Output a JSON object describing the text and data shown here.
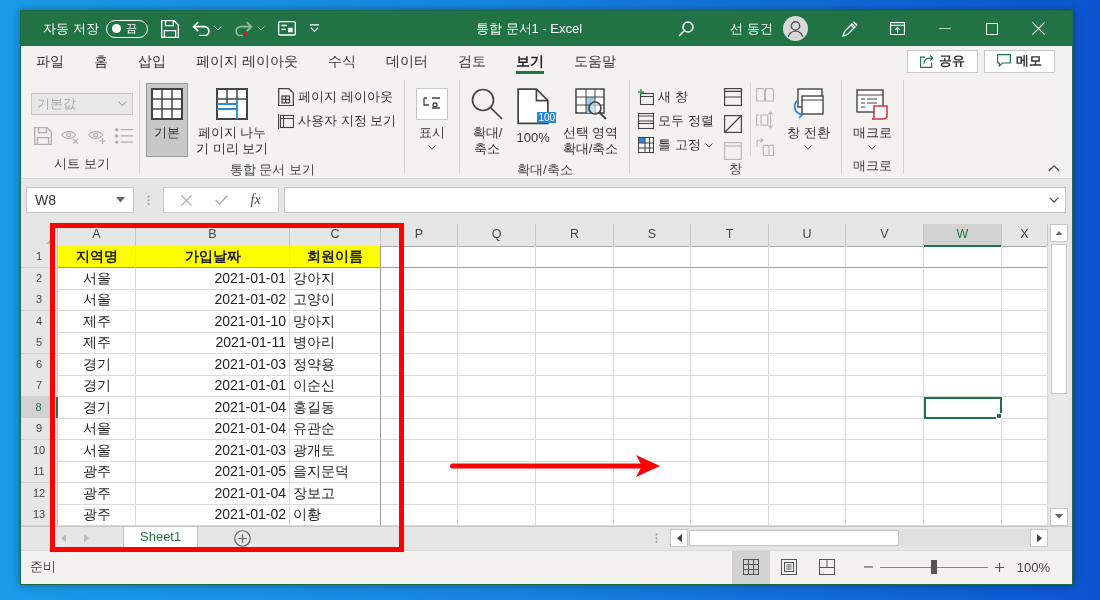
{
  "title_bar": {
    "autosave": {
      "label": "자동 저장",
      "state": "끔",
      "on": false
    },
    "quick_access": [
      {
        "kind": "save",
        "disabled": false,
        "dropdown": false
      },
      {
        "kind": "undo",
        "disabled": false,
        "dropdown": true
      },
      {
        "kind": "redo",
        "disabled": true,
        "dropdown": true
      },
      {
        "kind": "form",
        "disabled": false,
        "dropdown": false
      }
    ],
    "title": "통합 문서1 - Excel",
    "user": "선 동건"
  },
  "tabs": [
    {
      "label": "파일",
      "selected": false
    },
    {
      "label": "홈",
      "selected": false
    },
    {
      "label": "삽입",
      "selected": false
    },
    {
      "label": "페이지 레이아웃",
      "selected": false
    },
    {
      "label": "수식",
      "selected": false
    },
    {
      "label": "데이터",
      "selected": false
    },
    {
      "label": "검토",
      "selected": false
    },
    {
      "label": "보기",
      "selected": true
    },
    {
      "label": "도움말",
      "selected": false
    }
  ],
  "actions": [
    {
      "kind": "share",
      "label": "공유"
    },
    {
      "kind": "comment",
      "label": "메모"
    }
  ],
  "ribbon": {
    "groups": [
      {
        "kind": "sheet_view",
        "label": "시트 보기",
        "dropdown": {
          "value": "기본값",
          "disabled": true
        },
        "buttons": [
          {
            "kind": "save_view",
            "disabled": true
          },
          {
            "kind": "exit_view",
            "disabled": true
          },
          {
            "kind": "new_view",
            "disabled": true
          },
          {
            "kind": "view_options",
            "disabled": true
          }
        ]
      },
      {
        "kind": "commands",
        "label": "통합 문서 보기",
        "columns": [
          [
            {
              "kind": "normal_view",
              "lines": [
                "기본"
              ],
              "selected": true
            }
          ],
          [
            {
              "kind": "page_break_preview",
              "lines": [
                "페이지 나누",
                "기 미리 보기"
              ],
              "selected": false
            }
          ],
          [
            {
              "kind": "page_layout",
              "label": "페이지 레이아웃"
            },
            {
              "kind": "custom_views",
              "label": "사용자 지정 보기"
            }
          ]
        ]
      },
      {
        "kind": "commands",
        "columns": [
          [
            {
              "kind": "show",
              "lines": [
                "표시"
              ],
              "dropdown": true
            }
          ]
        ]
      },
      {
        "kind": "commands",
        "label": "확대/축소",
        "columns": [
          [
            {
              "kind": "zoom",
              "lines": [
                "확대/",
                "축소"
              ]
            }
          ],
          [
            {
              "kind": "zoom_100",
              "badge": "100",
              "lines": [
                "100%"
              ]
            }
          ],
          [
            {
              "kind": "zoom_selection",
              "lines": [
                "선택 영역",
                "확대/축소"
              ]
            }
          ]
        ]
      },
      {
        "kind": "commands",
        "label": "창",
        "columns": [
          [
            {
              "kind": "new_window",
              "label": "새 창"
            },
            {
              "kind": "arrange_all",
              "label": "모두 정렬"
            },
            {
              "kind": "freeze_panes",
              "label": "틀 고정",
              "dropdown": true
            }
          ],
          [
            {
              "kind": "split",
              "disabled": false
            },
            {
              "kind": "hide",
              "disabled": false
            },
            {
              "kind": "unhide",
              "disabled": true
            }
          ],
          [
            {
              "kind": "side_by_side",
              "disabled": true
            },
            {
              "kind": "sync_scroll",
              "disabled": true
            },
            {
              "kind": "reset_position",
              "disabled": true
            }
          ],
          [
            {
              "kind": "switch_windows",
              "lines": [
                "창 전환"
              ],
              "dropdown": true
            }
          ]
        ]
      },
      {
        "kind": "commands",
        "label": "매크로",
        "columns": [
          [
            {
              "kind": "macros",
              "lines": [
                "매크로"
              ],
              "dropdown": true
            }
          ]
        ]
      }
    ]
  },
  "formula_bar": {
    "name_box": "W8",
    "function_button": "fx"
  },
  "sheet": {
    "columns": [
      {
        "label": "A",
        "selected": false
      },
      {
        "label": "B",
        "selected": false
      },
      {
        "label": "C",
        "selected": false
      },
      {
        "label": "P",
        "selected": false
      },
      {
        "label": "Q",
        "selected": false
      },
      {
        "label": "R",
        "selected": false
      },
      {
        "label": "S",
        "selected": false
      },
      {
        "label": "T",
        "selected": false
      },
      {
        "label": "U",
        "selected": false
      },
      {
        "label": "V",
        "selected": false
      },
      {
        "label": "W",
        "selected": true
      },
      {
        "label": "X",
        "selected": false
      }
    ],
    "rows": [
      {
        "number": "1",
        "selected": false,
        "kind": "header",
        "cells": [
          "지역명",
          "가입날짜",
          "회원이름"
        ]
      },
      {
        "number": "2",
        "selected": false,
        "kind": "data",
        "cells": [
          "서울",
          "2021-01-01",
          "강아지"
        ]
      },
      {
        "number": "3",
        "selected": false,
        "kind": "data",
        "cells": [
          "서울",
          "2021-01-02",
          "고양이"
        ]
      },
      {
        "number": "4",
        "selected": false,
        "kind": "data",
        "cells": [
          "제주",
          "2021-01-10",
          "망아지"
        ]
      },
      {
        "number": "5",
        "selected": false,
        "kind": "data",
        "cells": [
          "제주",
          "2021-01-11",
          "병아리"
        ]
      },
      {
        "number": "6",
        "selected": false,
        "kind": "data",
        "cells": [
          "경기",
          "2021-01-03",
          "정약용"
        ]
      },
      {
        "number": "7",
        "selected": false,
        "kind": "data",
        "cells": [
          "경기",
          "2021-01-01",
          "이순신"
        ]
      },
      {
        "number": "8",
        "selected": true,
        "kind": "data",
        "cells": [
          "경기",
          "2021-01-04",
          "홍길동"
        ]
      },
      {
        "number": "9",
        "selected": false,
        "kind": "data",
        "cells": [
          "서울",
          "2021-01-04",
          "유관순"
        ]
      },
      {
        "number": "10",
        "selected": false,
        "kind": "data",
        "cells": [
          "서울",
          "2021-01-03",
          "광개토"
        ]
      },
      {
        "number": "11",
        "selected": false,
        "kind": "data",
        "cells": [
          "광주",
          "2021-01-05",
          "을지문덕"
        ]
      },
      {
        "number": "12",
        "selected": false,
        "kind": "data",
        "cells": [
          "광주",
          "2021-01-04",
          "장보고"
        ]
      },
      {
        "number": "13",
        "selected": false,
        "kind": "data",
        "cells": [
          "광주",
          "2021-01-02",
          "이황"
        ]
      }
    ]
  },
  "sheet_tabs": [
    {
      "label": "Sheet1",
      "selected": true
    }
  ],
  "status_bar": {
    "text": "준비",
    "views": [
      {
        "kind": "normal",
        "selected": true
      },
      {
        "kind": "page_layout",
        "selected": false
      },
      {
        "kind": "page_break",
        "selected": false
      }
    ],
    "zoom": {
      "level": 0.5,
      "label": "100%"
    }
  }
}
